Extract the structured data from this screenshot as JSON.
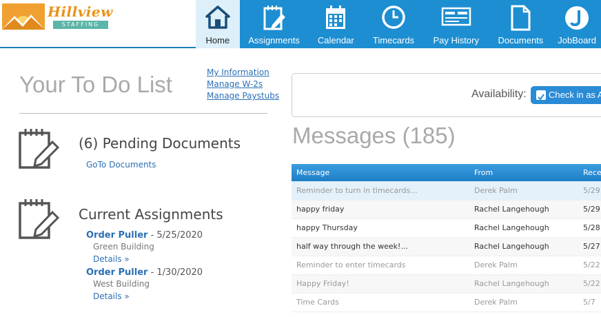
{
  "logo": {
    "name": "Hillview",
    "sub": "STAFFING"
  },
  "nav": [
    {
      "label": "Home",
      "icon": "house-icon",
      "active": true
    },
    {
      "label": "Assignments",
      "icon": "notepad-pencil-icon"
    },
    {
      "label": "Calendar",
      "icon": "calendar-icon"
    },
    {
      "label": "Timecards",
      "icon": "clock-icon"
    },
    {
      "label": "Pay History",
      "icon": "check-icon"
    },
    {
      "label": "Documents",
      "icon": "document-icon"
    },
    {
      "label": "JobBoard",
      "icon": "jobboard-icon"
    }
  ],
  "todo": {
    "title": "Your To Do List",
    "links": [
      "My Information",
      "Manage W-2s",
      "Manage Paystubs"
    ],
    "pending_title": "(6) Pending Documents",
    "goto_label": "GoTo Documents",
    "assign_title": "Current Assignments",
    "assignments": [
      {
        "role": "Order Puller",
        "date": " - 5/25/2020",
        "location": "Green Building",
        "details": "Details »"
      },
      {
        "role": "Order Puller",
        "date": " - 1/30/2020",
        "location": "West Building",
        "details": "Details »"
      }
    ]
  },
  "availability": {
    "label": "Availability:",
    "button": "Check in as Av"
  },
  "messages": {
    "title": "Messages (185)",
    "headers": [
      "Message",
      "From",
      "Rece"
    ],
    "rows": [
      {
        "message": "Reminder to turn in timecards...",
        "from": "Derek Palm",
        "date": "5/29",
        "read": true
      },
      {
        "message": "happy friday",
        "from": "Rachel Langehough",
        "date": "5/29",
        "read": false
      },
      {
        "message": "happy Thursday",
        "from": "Rachel Langehough",
        "date": "5/28",
        "read": false
      },
      {
        "message": "half way through the week!...",
        "from": "Rachel Langehough",
        "date": "5/27",
        "read": false
      },
      {
        "message": "Reminder to enter timecards",
        "from": "Derek Palm",
        "date": "5/22",
        "read": true
      },
      {
        "message": "Happy Friday!",
        "from": "Rachel Langehough",
        "date": "5/22",
        "read": true
      },
      {
        "message": "Time Cards",
        "from": "Derek Palm",
        "date": "5/7",
        "read": true
      }
    ]
  },
  "colors": {
    "nav_bg": "#1d8ed1",
    "link": "#2b6fb5",
    "logo_orange": "#e8941a"
  }
}
